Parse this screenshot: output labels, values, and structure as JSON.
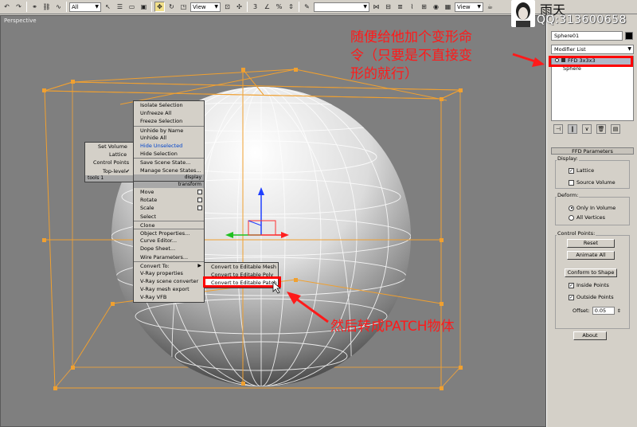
{
  "toolbar": {
    "filter_value": "All",
    "refcoord_value": "View",
    "named_sel_value": "",
    "view2_value": "View"
  },
  "watermark": {
    "name": "雨天",
    "qq": "QQ:313600658"
  },
  "viewport": {
    "label": "Perspective"
  },
  "quad_left": {
    "items": [
      {
        "label": "Set Volume"
      },
      {
        "label": "Lattice"
      },
      {
        "label": "Control Points"
      },
      {
        "label": "Top-level",
        "check": "✔"
      }
    ],
    "header": "tools 1"
  },
  "quad_display": {
    "items": [
      {
        "label": "Isolate Selection"
      },
      {
        "label": "Unfreeze All"
      },
      {
        "label": "Freeze Selection"
      },
      {
        "label": "Unhide by Name"
      },
      {
        "label": "Unhide All"
      },
      {
        "label": "Hide Unselected"
      },
      {
        "label": "Hide Selection"
      },
      {
        "label": "Save Scene State..."
      },
      {
        "label": "Manage Scene States..."
      }
    ],
    "header": "display"
  },
  "quad_transform": {
    "header": "transform",
    "items": [
      {
        "label": "Move"
      },
      {
        "label": "Rotate"
      },
      {
        "label": "Scale"
      },
      {
        "label": "Select"
      },
      {
        "label": "Clone"
      },
      {
        "label": "Object Properties..."
      },
      {
        "label": "Curve Editor..."
      },
      {
        "label": "Dope Sheet..."
      },
      {
        "label": "Wire Parameters..."
      },
      {
        "label": "Convert To:"
      },
      {
        "label": "V-Ray properties"
      },
      {
        "label": "V-Ray scene converter"
      },
      {
        "label": "V-Ray mesh export"
      },
      {
        "label": "V-Ray VFB"
      }
    ]
  },
  "submenu": {
    "items": [
      {
        "label": "Convert to Editable Mesh"
      },
      {
        "label": "Convert to Editable Poly"
      },
      {
        "label": "Convert to Editable Patch"
      }
    ]
  },
  "panel": {
    "object_name": "Sphere01",
    "modifier_list": "Modifier List",
    "stack": [
      {
        "label": "FFD 3x3x3"
      },
      {
        "label": "Sphere"
      }
    ],
    "rollout_title": "FFD Parameters",
    "display_group": "Display:",
    "lattice": "Lattice",
    "source_volume": "Source Volume",
    "deform_group": "Deform:",
    "only_in_volume": "Only In Volume",
    "all_vertices": "All Vertices",
    "cp_group": "Control Points:",
    "reset": "Reset",
    "animate_all": "Animate All",
    "conform": "Conform to Shape",
    "inside_points": "Inside Points",
    "outside_points": "Outside Points",
    "offset_label": "Offset:",
    "offset_value": "0.05",
    "about": "About"
  },
  "annotations": {
    "top_line1": "随便给他加个变形命",
    "top_line2": "令（只要是不直接变",
    "top_line3": "形的就行）",
    "bottom": "然后转成PATCH物体"
  },
  "colors": {
    "annotation_red": "#ff1a1a",
    "lattice_orange": "#f0a030",
    "viewport_bg": "#7f7f7f"
  }
}
